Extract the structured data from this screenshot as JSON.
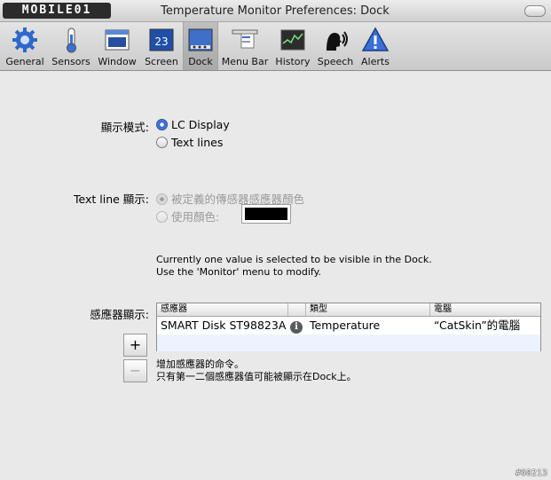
{
  "window": {
    "logo_text": "MOBILE01",
    "title": "Temperature Monitor Preferences: Dock"
  },
  "toolbar": {
    "items": [
      {
        "label": "General",
        "icon": "gear-icon"
      },
      {
        "label": "Sensors",
        "icon": "thermometer-icon"
      },
      {
        "label": "Window",
        "icon": "window-icon"
      },
      {
        "label": "Screen",
        "icon": "calendar-screen-icon"
      },
      {
        "label": "Dock",
        "icon": "dock-icon",
        "selected": true
      },
      {
        "label": "Menu Bar",
        "icon": "menu-bar-icon"
      },
      {
        "label": "History",
        "icon": "history-chart-icon"
      },
      {
        "label": "Speech",
        "icon": "speech-head-icon"
      },
      {
        "label": "Alerts",
        "icon": "alert-triangle-icon"
      }
    ],
    "calendar_day": "23"
  },
  "display_mode": {
    "label": "顯示模式:",
    "options": [
      "LC Display",
      "Text lines"
    ],
    "selected": "LC Display"
  },
  "text_line_display": {
    "label": "Text line 顯示:",
    "options": [
      "被定義的傳感器感應器顏色",
      "使用顏色:"
    ],
    "selected": "被定義的傳感器感應器顏色",
    "color": "#000000"
  },
  "info_text": [
    "Currently one value is selected to be visible in the Dock.",
    "Use the 'Monitor' menu to modify."
  ],
  "sensor_display": {
    "label": "感應器顯示:",
    "columns": [
      "感應器",
      "類型",
      "電腦"
    ],
    "rows": [
      {
        "sensor": "SMART Disk ST98823A",
        "type": "Temperature",
        "computer": "“CatSkin”的電腦"
      }
    ],
    "add_label": "+",
    "remove_label": "−"
  },
  "hint_text": [
    "增加感應器的命令。",
    "只有第一二個感應器值可能被顯示在Dock上。"
  ],
  "watermark": "#60213"
}
